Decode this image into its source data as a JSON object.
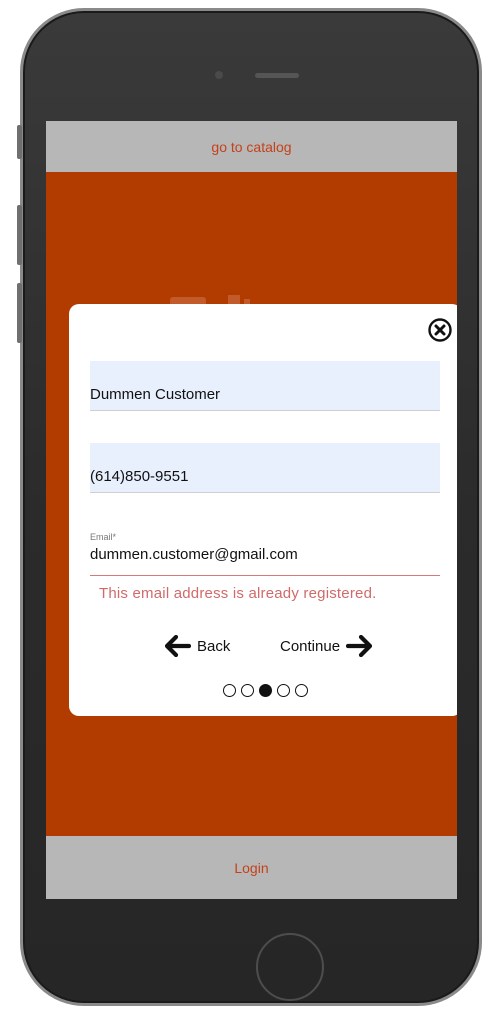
{
  "header": {
    "catalog_link": "go to catalog"
  },
  "footer": {
    "login_label": "Login"
  },
  "modal": {
    "name_value": "Dummen Customer",
    "phone_value": "(614)850-9551",
    "email_label": "Email*",
    "email_value": "dummen.customer@gmail.com",
    "error_message": "This email address is already registered.",
    "back_label": "Back",
    "continue_label": "Continue",
    "steps_total": 5,
    "steps_current": 3
  },
  "colors": {
    "screen_bg": "#b23c00",
    "bar_bg": "#b7b7b7",
    "link_text": "#c4411a",
    "autofill_bg": "#e8f0fe",
    "error_text": "#d16a6a"
  },
  "icons": {
    "close": "close-circle-icon",
    "back": "arrow-left-icon",
    "continue": "arrow-right-icon"
  }
}
